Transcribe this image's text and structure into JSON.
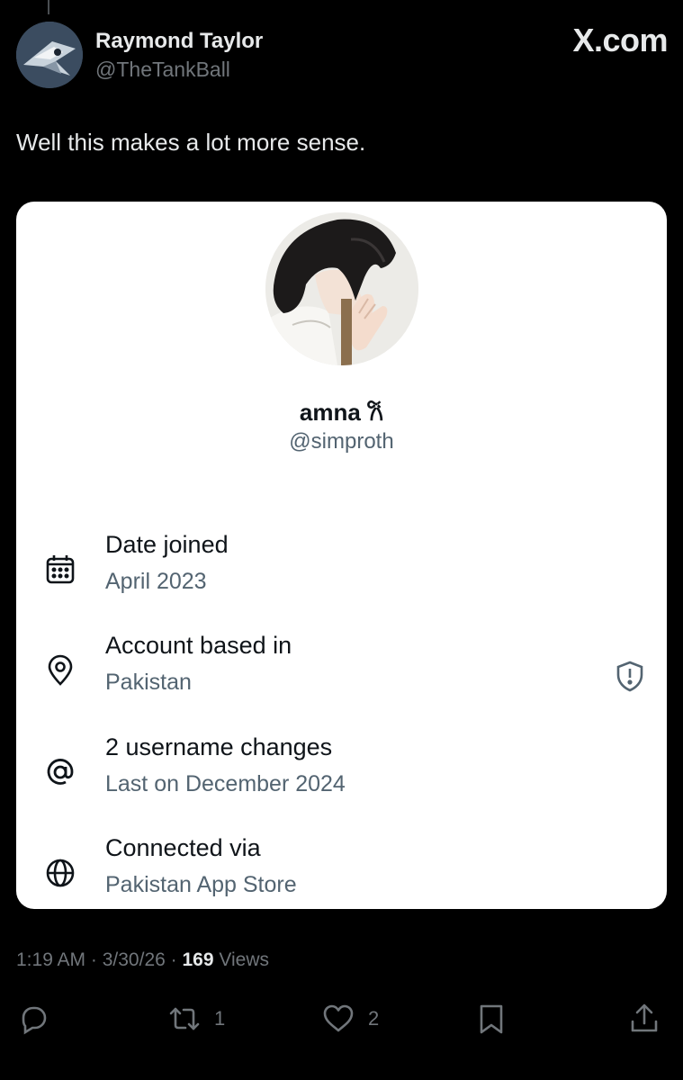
{
  "author": {
    "name": "Raymond Taylor",
    "handle": "@TheTankBall"
  },
  "brand": "X.com",
  "post_text": "Well this makes a lot more sense.",
  "profile": {
    "name": "amna 𐙚",
    "handle": "@simproth",
    "info": [
      {
        "icon": "calendar-icon",
        "title": "Date joined",
        "subtitle": "April 2023"
      },
      {
        "icon": "location-pin-icon",
        "title": "Account based in",
        "subtitle": "Pakistan"
      },
      {
        "icon": "at-sign-icon",
        "title": "2 username changes",
        "subtitle": "Last on December 2024"
      },
      {
        "icon": "globe-icon",
        "title": "Connected via",
        "subtitle": "Pakistan App Store"
      }
    ]
  },
  "meta": {
    "time": "1:19 AM",
    "date": "3/30/26",
    "views_count": "169",
    "views_label": "Views"
  },
  "actions": {
    "reply_icon": "reply-icon",
    "retweet_icon": "retweet-icon",
    "retweet_count": "1",
    "like_icon": "heart-icon",
    "like_count": "2",
    "bookmark_icon": "bookmark-icon",
    "share_icon": "share-icon"
  },
  "colors": {
    "background": "#000000",
    "text_primary": "#e7e9ea",
    "text_secondary": "#71767b",
    "card_background": "#ffffff",
    "card_text": "#0f1419",
    "card_secondary": "#536471"
  }
}
